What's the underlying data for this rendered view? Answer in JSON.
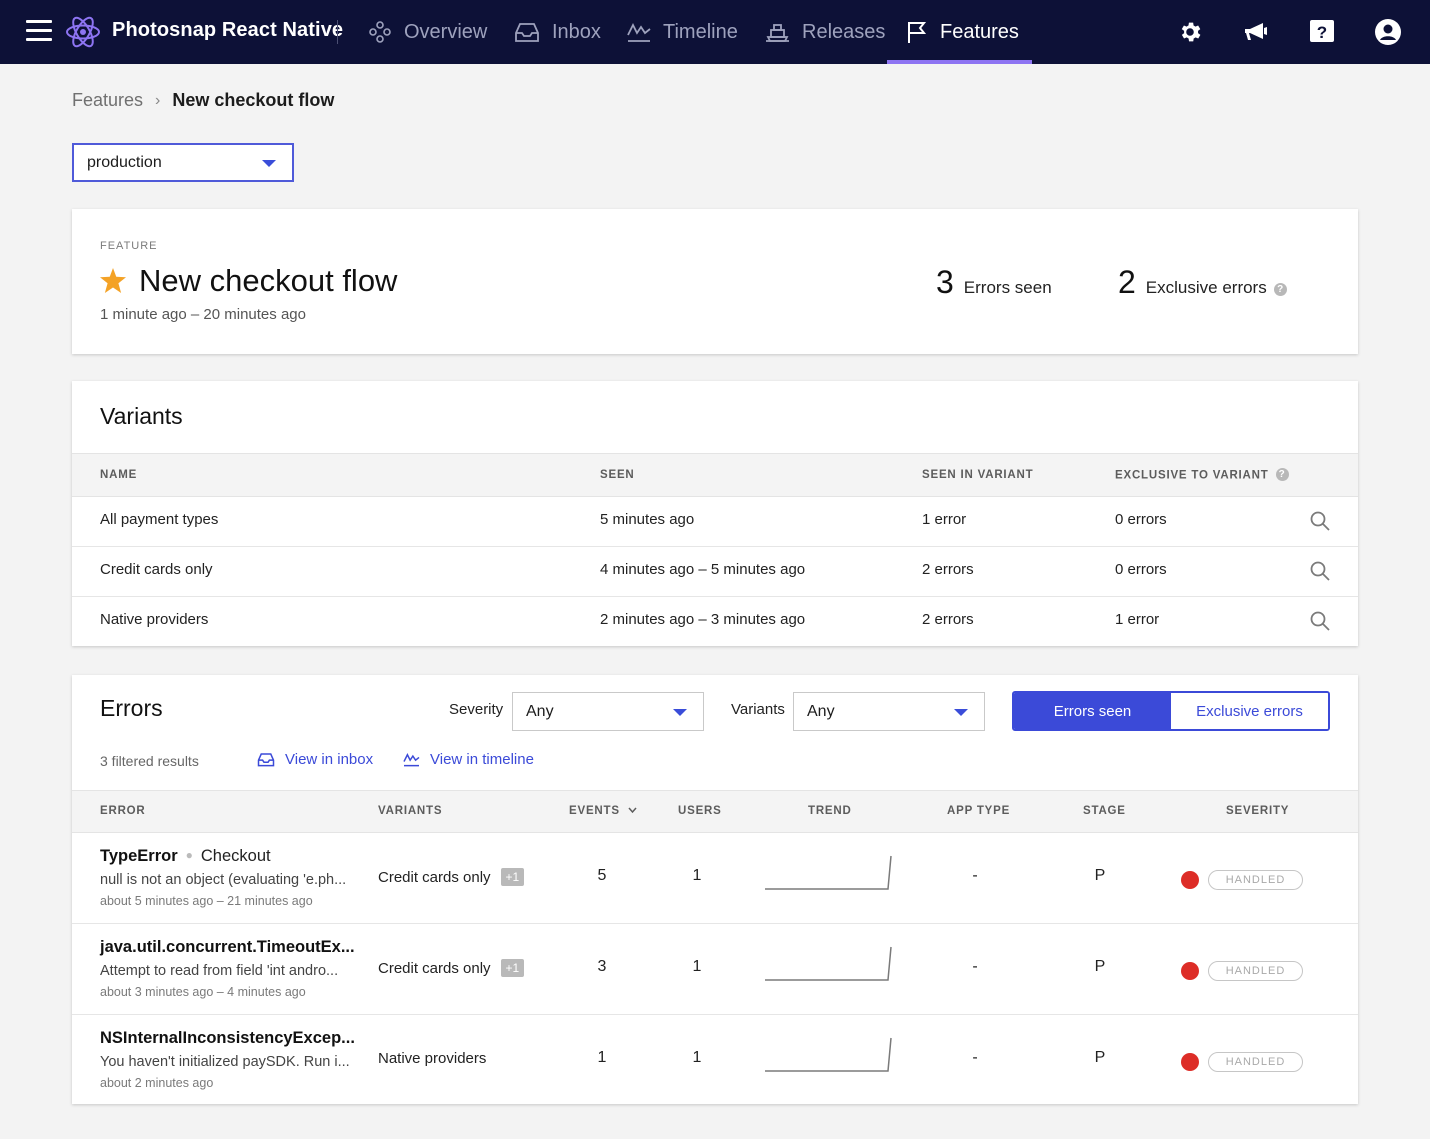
{
  "nav": {
    "app_name": "Photosnap React Native",
    "items": [
      {
        "label": "Overview",
        "icon": "overview-icon"
      },
      {
        "label": "Inbox",
        "icon": "inbox-icon"
      },
      {
        "label": "Timeline",
        "icon": "timeline-icon"
      },
      {
        "label": "Releases",
        "icon": "releases-icon"
      },
      {
        "label": "Features",
        "icon": "flag-icon",
        "active": true
      }
    ],
    "right_icons": [
      "gear-icon",
      "megaphone-icon",
      "help-icon",
      "account-icon"
    ]
  },
  "breadcrumb": {
    "parent": "Features",
    "separator": "›",
    "current": "New checkout flow"
  },
  "environment": {
    "selected": "production"
  },
  "feature": {
    "eyebrow": "FEATURE",
    "title": "New checkout flow",
    "range": "1 minute ago – 20 minutes ago",
    "errors_seen_count": "3",
    "errors_seen_label": "Errors seen",
    "exclusive_count": "2",
    "exclusive_label": "Exclusive errors"
  },
  "variants": {
    "heading": "Variants",
    "columns": {
      "name": "Name",
      "seen": "Seen",
      "seen_in_variant": "Seen in variant",
      "exclusive": "Exclusive to variant"
    },
    "rows": [
      {
        "name": "All payment types",
        "seen": "5 minutes ago",
        "seen_in_variant": "1 error",
        "exclusive": "0 errors"
      },
      {
        "name": "Credit cards only",
        "seen": "4 minutes ago – 5 minutes ago",
        "seen_in_variant": "2 errors",
        "exclusive": "0 errors"
      },
      {
        "name": "Native providers",
        "seen": "2 minutes ago – 3 minutes ago",
        "seen_in_variant": "2 errors",
        "exclusive": "1 error"
      }
    ]
  },
  "errors": {
    "heading": "Errors",
    "severity_label": "Severity",
    "severity_value": "Any",
    "variants_label": "Variants",
    "variants_value": "Any",
    "toggle_on": "Errors seen",
    "toggle_off": "Exclusive errors",
    "filtered": "3 filtered results",
    "view_inbox": "View in inbox",
    "view_timeline": "View in timeline",
    "columns": {
      "error": "Error",
      "variants": "Variants",
      "events": "Events",
      "users": "Users",
      "trend": "Trend",
      "app_type": "App type",
      "stage": "Stage",
      "severity": "Severity"
    },
    "rows": [
      {
        "class": "TypeError",
        "context": "Checkout",
        "message": "null is not an object (evaluating 'e.ph...",
        "time": "about 5 minutes ago – 21 minutes ago",
        "variant": "Credit cards only",
        "extra": "+1",
        "events": "5",
        "users": "1",
        "app_type": "-",
        "stage": "P",
        "severity": "HANDLED"
      },
      {
        "class": "java.util.concurrent.TimeoutEx...",
        "context": "",
        "message": "Attempt to read from field 'int andro...",
        "time": "about 3 minutes ago – 4 minutes ago",
        "variant": "Credit cards only",
        "extra": "+1",
        "events": "3",
        "users": "1",
        "app_type": "-",
        "stage": "P",
        "severity": "HANDLED"
      },
      {
        "class": "NSInternalInconsistencyExcep...",
        "context": "",
        "message": "You haven't initialized paySDK. Run i...",
        "time": "about 2 minutes ago",
        "variant": "Native providers",
        "extra": "",
        "events": "1",
        "users": "1",
        "app_type": "-",
        "stage": "P",
        "severity": "HANDLED"
      }
    ]
  },
  "colors": {
    "nav_bg": "#0d1137",
    "accent": "#3b4ad8",
    "active_tab": "#8d74f2",
    "error_dot": "#dd2d27",
    "star": "#f4a226"
  }
}
